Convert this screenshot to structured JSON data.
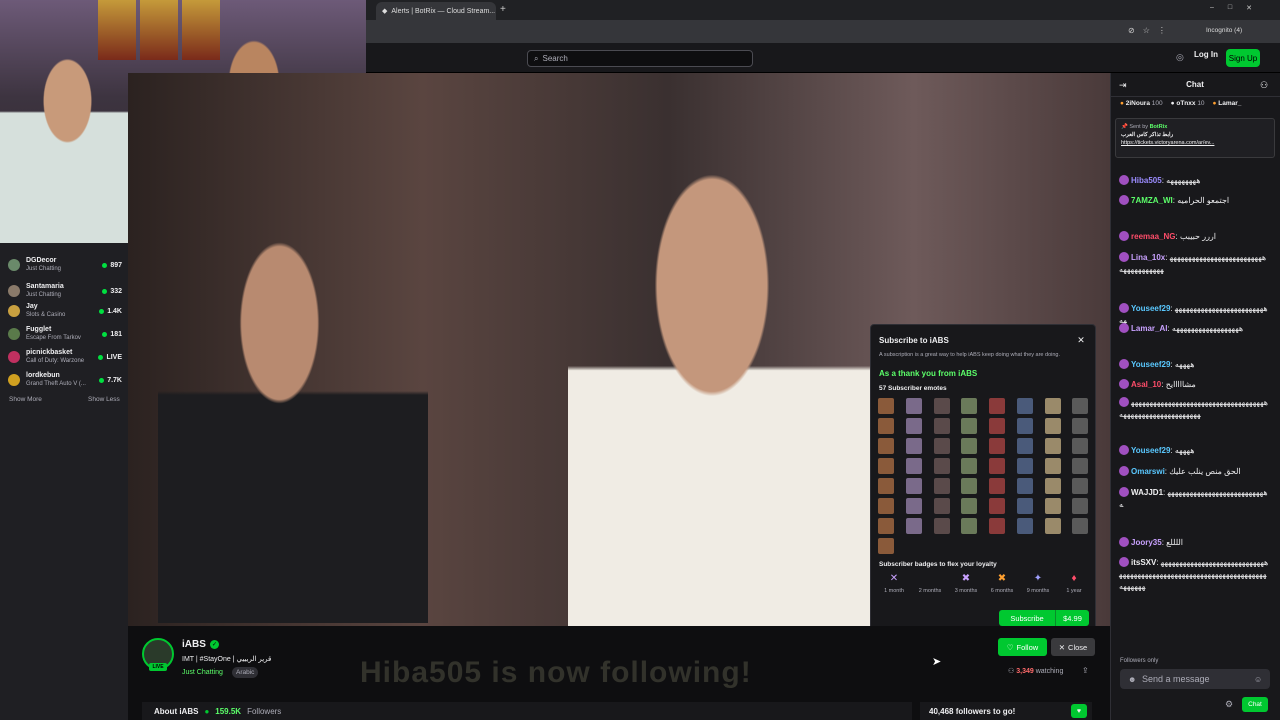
{
  "browser": {
    "tab_title": "Alerts | BotRix — Cloud Stream...",
    "incognito": "Incognito (4)"
  },
  "topnav": {
    "search_placeholder": "Search",
    "login": "Log In",
    "signup": "Sign Up"
  },
  "sidebar": {
    "channels": [
      {
        "name": "DGDecor",
        "game": "Just Chatting",
        "viewers": "897"
      },
      {
        "name": "Santamaria",
        "game": "Just Chatting",
        "viewers": "332"
      },
      {
        "name": "Jay",
        "game": "Slots & Casino",
        "viewers": "1.4K"
      },
      {
        "name": "Fugglet",
        "game": "Escape From Tarkov",
        "viewers": "181"
      },
      {
        "name": "picnickbasket",
        "game": "Call of Duty: Warzone",
        "viewers": "LIVE"
      },
      {
        "name": "lordkebun",
        "game": "Grand Theft Auto V (...",
        "viewers": "7.7K"
      }
    ],
    "show_more": "Show More",
    "show_less": "Show Less"
  },
  "sub_modal": {
    "title": "Subscribe to iABS",
    "description": "A subscription is a great way to help iABS keep doing what they are doing.",
    "thanks": "As a thank you from iABS",
    "emotes_label": "57 Subscriber emotes",
    "badges_label": "Subscriber badges to flex your loyalty",
    "badges": [
      "1 month",
      "2 months",
      "3 months",
      "6 months",
      "9 months",
      "1 year"
    ],
    "subscribe": "Subscribe",
    "price": "$4.99"
  },
  "stream": {
    "channel": "iABS",
    "title": "IMT | #StayOne | قرير الريييي",
    "category": "Just Chatting",
    "language": "Arabic",
    "live": "LIVE",
    "follow": "Follow",
    "close": "Close",
    "watching_count": "3,349",
    "watching_label": "watching",
    "about": "About iABS",
    "followers": "159.5K",
    "followers_label": "Followers",
    "goal": "40,468 followers to go!",
    "overlay": "Hiba505 is now following!"
  },
  "chat": {
    "header": "Chat",
    "gifters": [
      {
        "name": "2iNoura",
        "count": "100"
      },
      {
        "name": "oTnxx",
        "count": "10"
      },
      {
        "name": "Lamar_",
        "count": ""
      }
    ],
    "pinned": {
      "sent_by": "Sent by",
      "bot": "BotRix",
      "text": "رابط تذاكر كاس العرب",
      "link": "https://tickets.victoryarena.com/ar/ev..."
    },
    "messages": [
      {
        "user": "Hiba505",
        "color": "#9b8cff",
        "text": ": ههههههههه"
      },
      {
        "user": "7AMZA_WI",
        "color": "#5cff6a",
        "text": ": اجتمعو الحراميه"
      },
      {
        "user": "reemaa_NG",
        "color": "#ff4d6a",
        "text": ": اررر حبيبب"
      },
      {
        "user": "Lina_10x",
        "color": "#c9a1ff",
        "text": ": هههههههههههههههههههههههههههههههههههههه"
      },
      {
        "user": "Youseef29",
        "color": "#5ac8ff",
        "text": ": ههههههههههههههههههههههههههه"
      },
      {
        "user": "Lamar_Al",
        "color": "#c9a1ff",
        "text": ": ههههههههههههههههههه"
      },
      {
        "user": "Youseef29",
        "color": "#5ac8ff",
        "text": ": ههههه"
      },
      {
        "user": "Asal_10",
        "color": "#ff4d6a",
        "text": ": مشااااايح"
      },
      {
        "user": "",
        "color": "#efeff1",
        "text": "ههههههههههههههههههههههههههههههههههههههههههههههههههههههههههه"
      },
      {
        "user": "Youseef29",
        "color": "#5ac8ff",
        "text": ": ههههه"
      },
      {
        "user": "Omarswi",
        "color": "#5ac8ff",
        "text": ": الحق منص ينلب عليك"
      },
      {
        "user": "WAJJD1",
        "color": "#efeff1",
        "text": ": هههههههههههههههههههههههههههه"
      },
      {
        "user": "Joory35",
        "color": "#c9a1ff",
        "text": ": اللللع"
      },
      {
        "user": "itsSXV",
        "color": "#efeff1",
        "text": ": هههههههههههههههههههههههههههههههههههههههههههههههههههههههههههههههههههههههههههه"
      }
    ],
    "followers_only": "Followers only",
    "send_placeholder": "Send a message",
    "chat_button": "Chat"
  }
}
